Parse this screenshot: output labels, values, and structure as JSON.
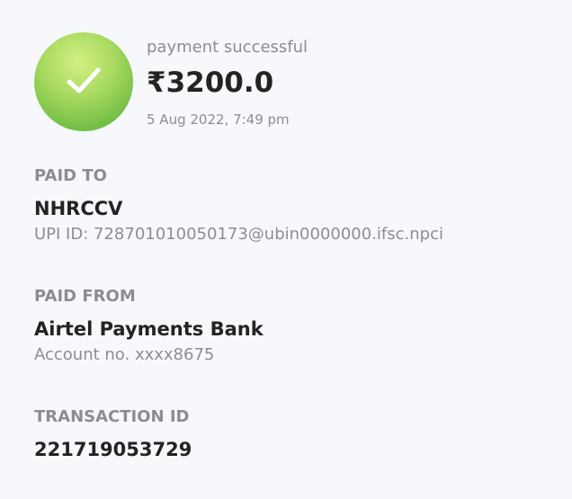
{
  "status": {
    "text": "payment successful",
    "amount": "₹3200.0",
    "datetime": "5 Aug 2022, 7:49 pm",
    "icon": "check-icon",
    "icon_color_light": "#d6ef84",
    "icon_color_dark": "#5fb33b"
  },
  "paid_to": {
    "label": "PAID TO",
    "name": "NHRCCV",
    "upi": "UPI ID: 728701010050173@ubin0000000.ifsc.npci"
  },
  "paid_from": {
    "label": "PAID FROM",
    "bank": "Airtel Payments Bank",
    "account": "Account no. xxxx8675"
  },
  "transaction": {
    "label": "TRANSACTION ID",
    "id": "221719053729"
  }
}
